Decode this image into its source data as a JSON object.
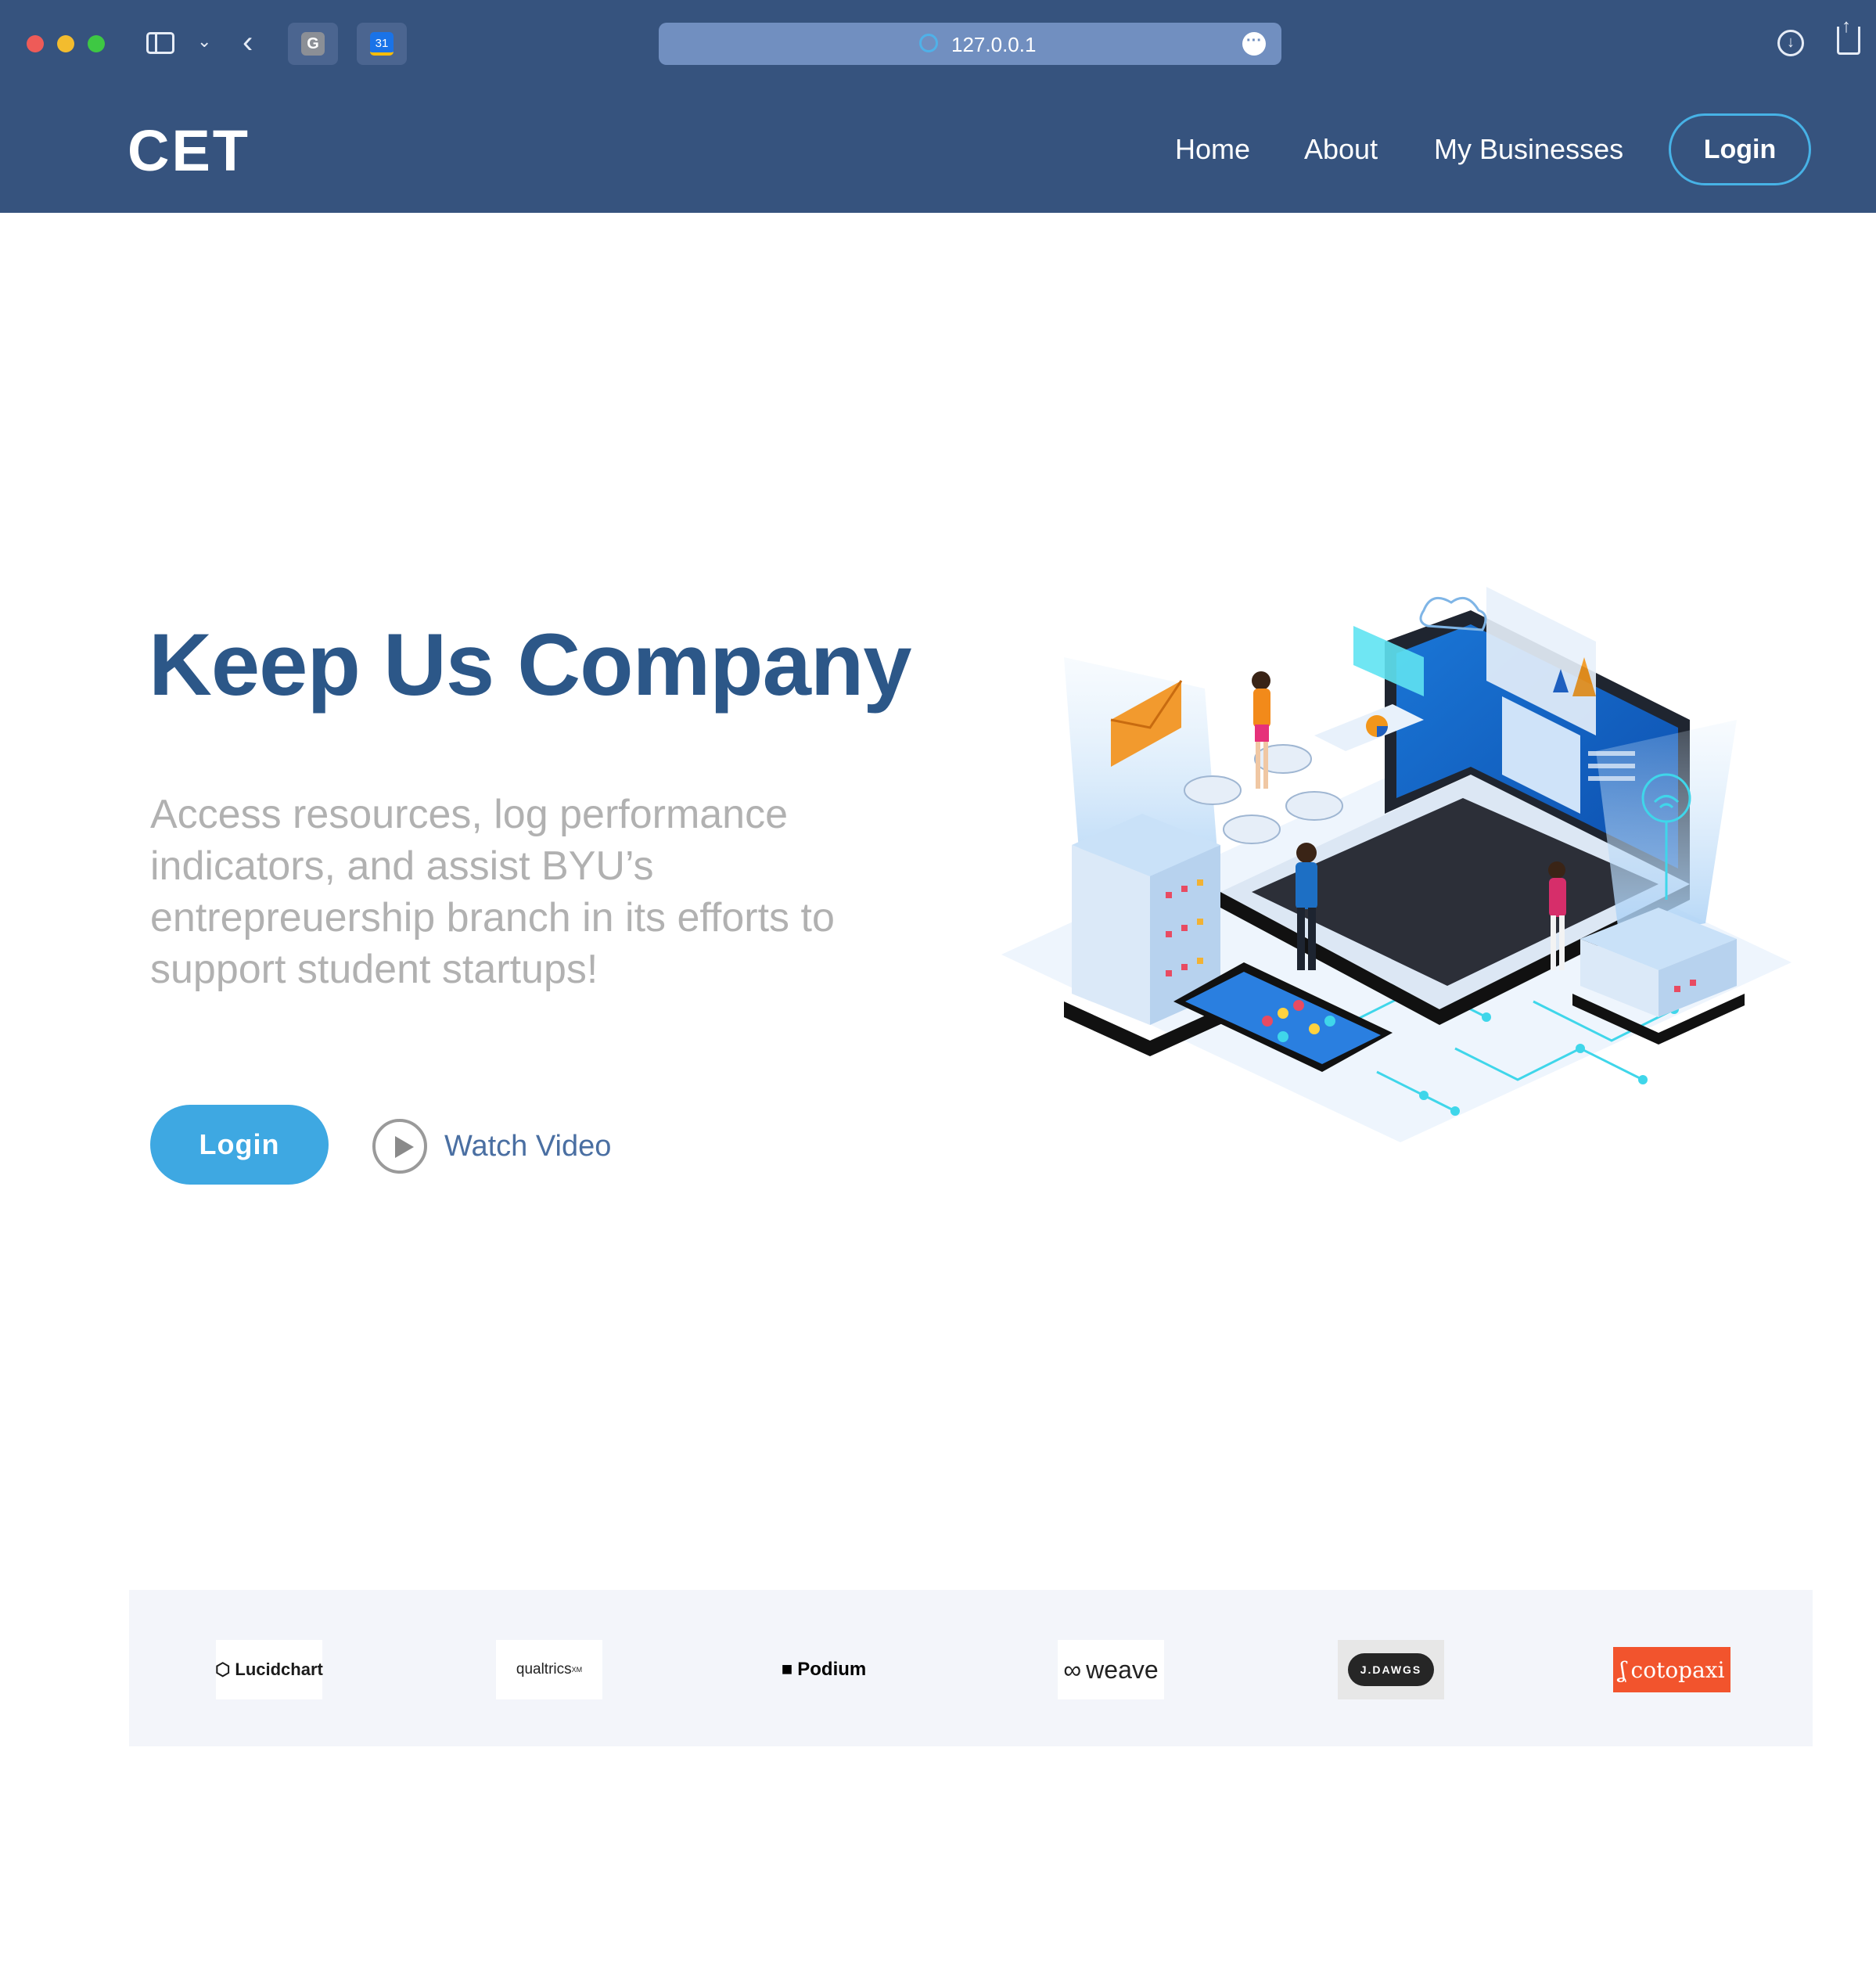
{
  "browser": {
    "url": "127.0.0.1",
    "tabs": [
      {
        "icon": "g-tab-icon",
        "label": "G"
      },
      {
        "icon": "calendar-tab-icon",
        "label": "31"
      }
    ],
    "more_label": "···"
  },
  "header": {
    "logo": "CET",
    "nav": {
      "home": "Home",
      "about": "About",
      "businesses": "My Businesses",
      "login": "Login"
    }
  },
  "hero": {
    "title": "Keep Us Company",
    "text": "Access resources, log performance indicators, and assist BYU’s entrepreuership branch in its efforts to support student startups!",
    "login_label": "Login",
    "video_label": "Watch Video"
  },
  "clients": [
    {
      "name": "Lucidchart"
    },
    {
      "name": "qualtrics",
      "mark": "XM"
    },
    {
      "name": "Podium"
    },
    {
      "name": "weave"
    },
    {
      "name": "J.DAWGS"
    },
    {
      "name": "cotopaxi"
    }
  ],
  "colors": {
    "chrome": "#36537e",
    "title": "#2c5788",
    "accent": "#3ea8e2",
    "muted_text": "#b1b1b1"
  }
}
